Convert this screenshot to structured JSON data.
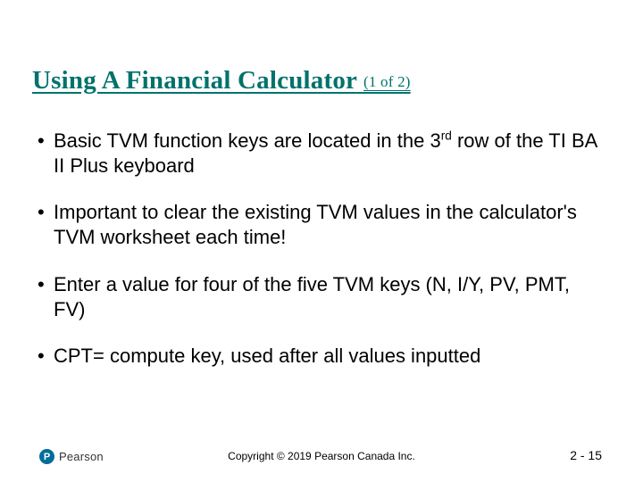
{
  "title": {
    "main": "Using A Financial Calculator",
    "paren": "(1 of 2)"
  },
  "bullets": [
    {
      "pre": "Basic TVM function keys are located in the 3",
      "sup": "rd",
      "post": " row of the TI BA II Plus keyboard"
    },
    {
      "pre": "Important to clear the existing TVM values in the calculator's TVM worksheet each time!",
      "sup": "",
      "post": ""
    },
    {
      "pre": "Enter a value for four of the five TVM keys (N, I/Y, PV, PMT, FV)",
      "sup": "",
      "post": ""
    },
    {
      "pre": "CPT= compute key, used after all values inputted",
      "sup": "",
      "post": ""
    }
  ],
  "footer": {
    "logo_letter": "P",
    "logo_text": "Pearson",
    "copyright": "Copyright © 2019 Pearson Canada Inc.",
    "pagenum": "2 - 15"
  }
}
